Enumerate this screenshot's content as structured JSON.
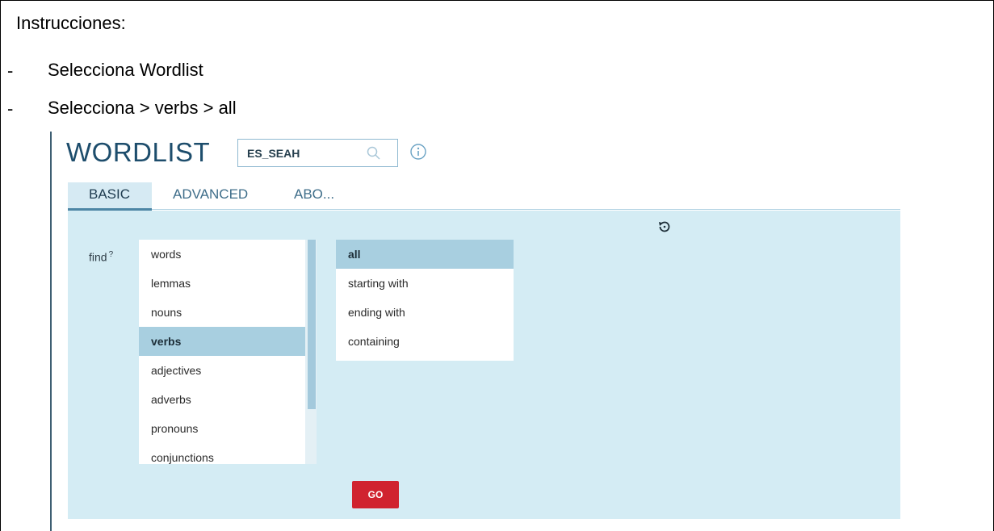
{
  "instructions": {
    "title": "Instrucciones:",
    "steps": [
      {
        "bullet": "-",
        "text": "Selecciona Wordlist"
      },
      {
        "bullet": "-",
        "text": "Selecciona > verbs > all"
      }
    ]
  },
  "app": {
    "title": "WORDLIST",
    "corpus_value": "ES_SEAH",
    "icons": {
      "search": "search-icon",
      "info": "info-icon",
      "reset": "reset-icon"
    },
    "tabs": [
      {
        "label": "BASIC",
        "active": true
      },
      {
        "label": "ADVANCED",
        "active": false
      },
      {
        "label": "ABO...",
        "active": false
      }
    ],
    "find": {
      "label": "find",
      "help": "?"
    },
    "find_options": [
      "words",
      "lemmas",
      "nouns",
      "verbs",
      "adjectives",
      "adverbs",
      "pronouns",
      "conjunctions"
    ],
    "find_selected": "verbs",
    "match_options": [
      "all",
      "starting with",
      "ending with",
      "containing"
    ],
    "match_selected": "all",
    "go_label": "GO"
  },
  "colors": {
    "title": "#1d4d6c",
    "panel": "#d4ecf4",
    "selected": "#a8cfe0",
    "go_button": "#d0232f"
  }
}
